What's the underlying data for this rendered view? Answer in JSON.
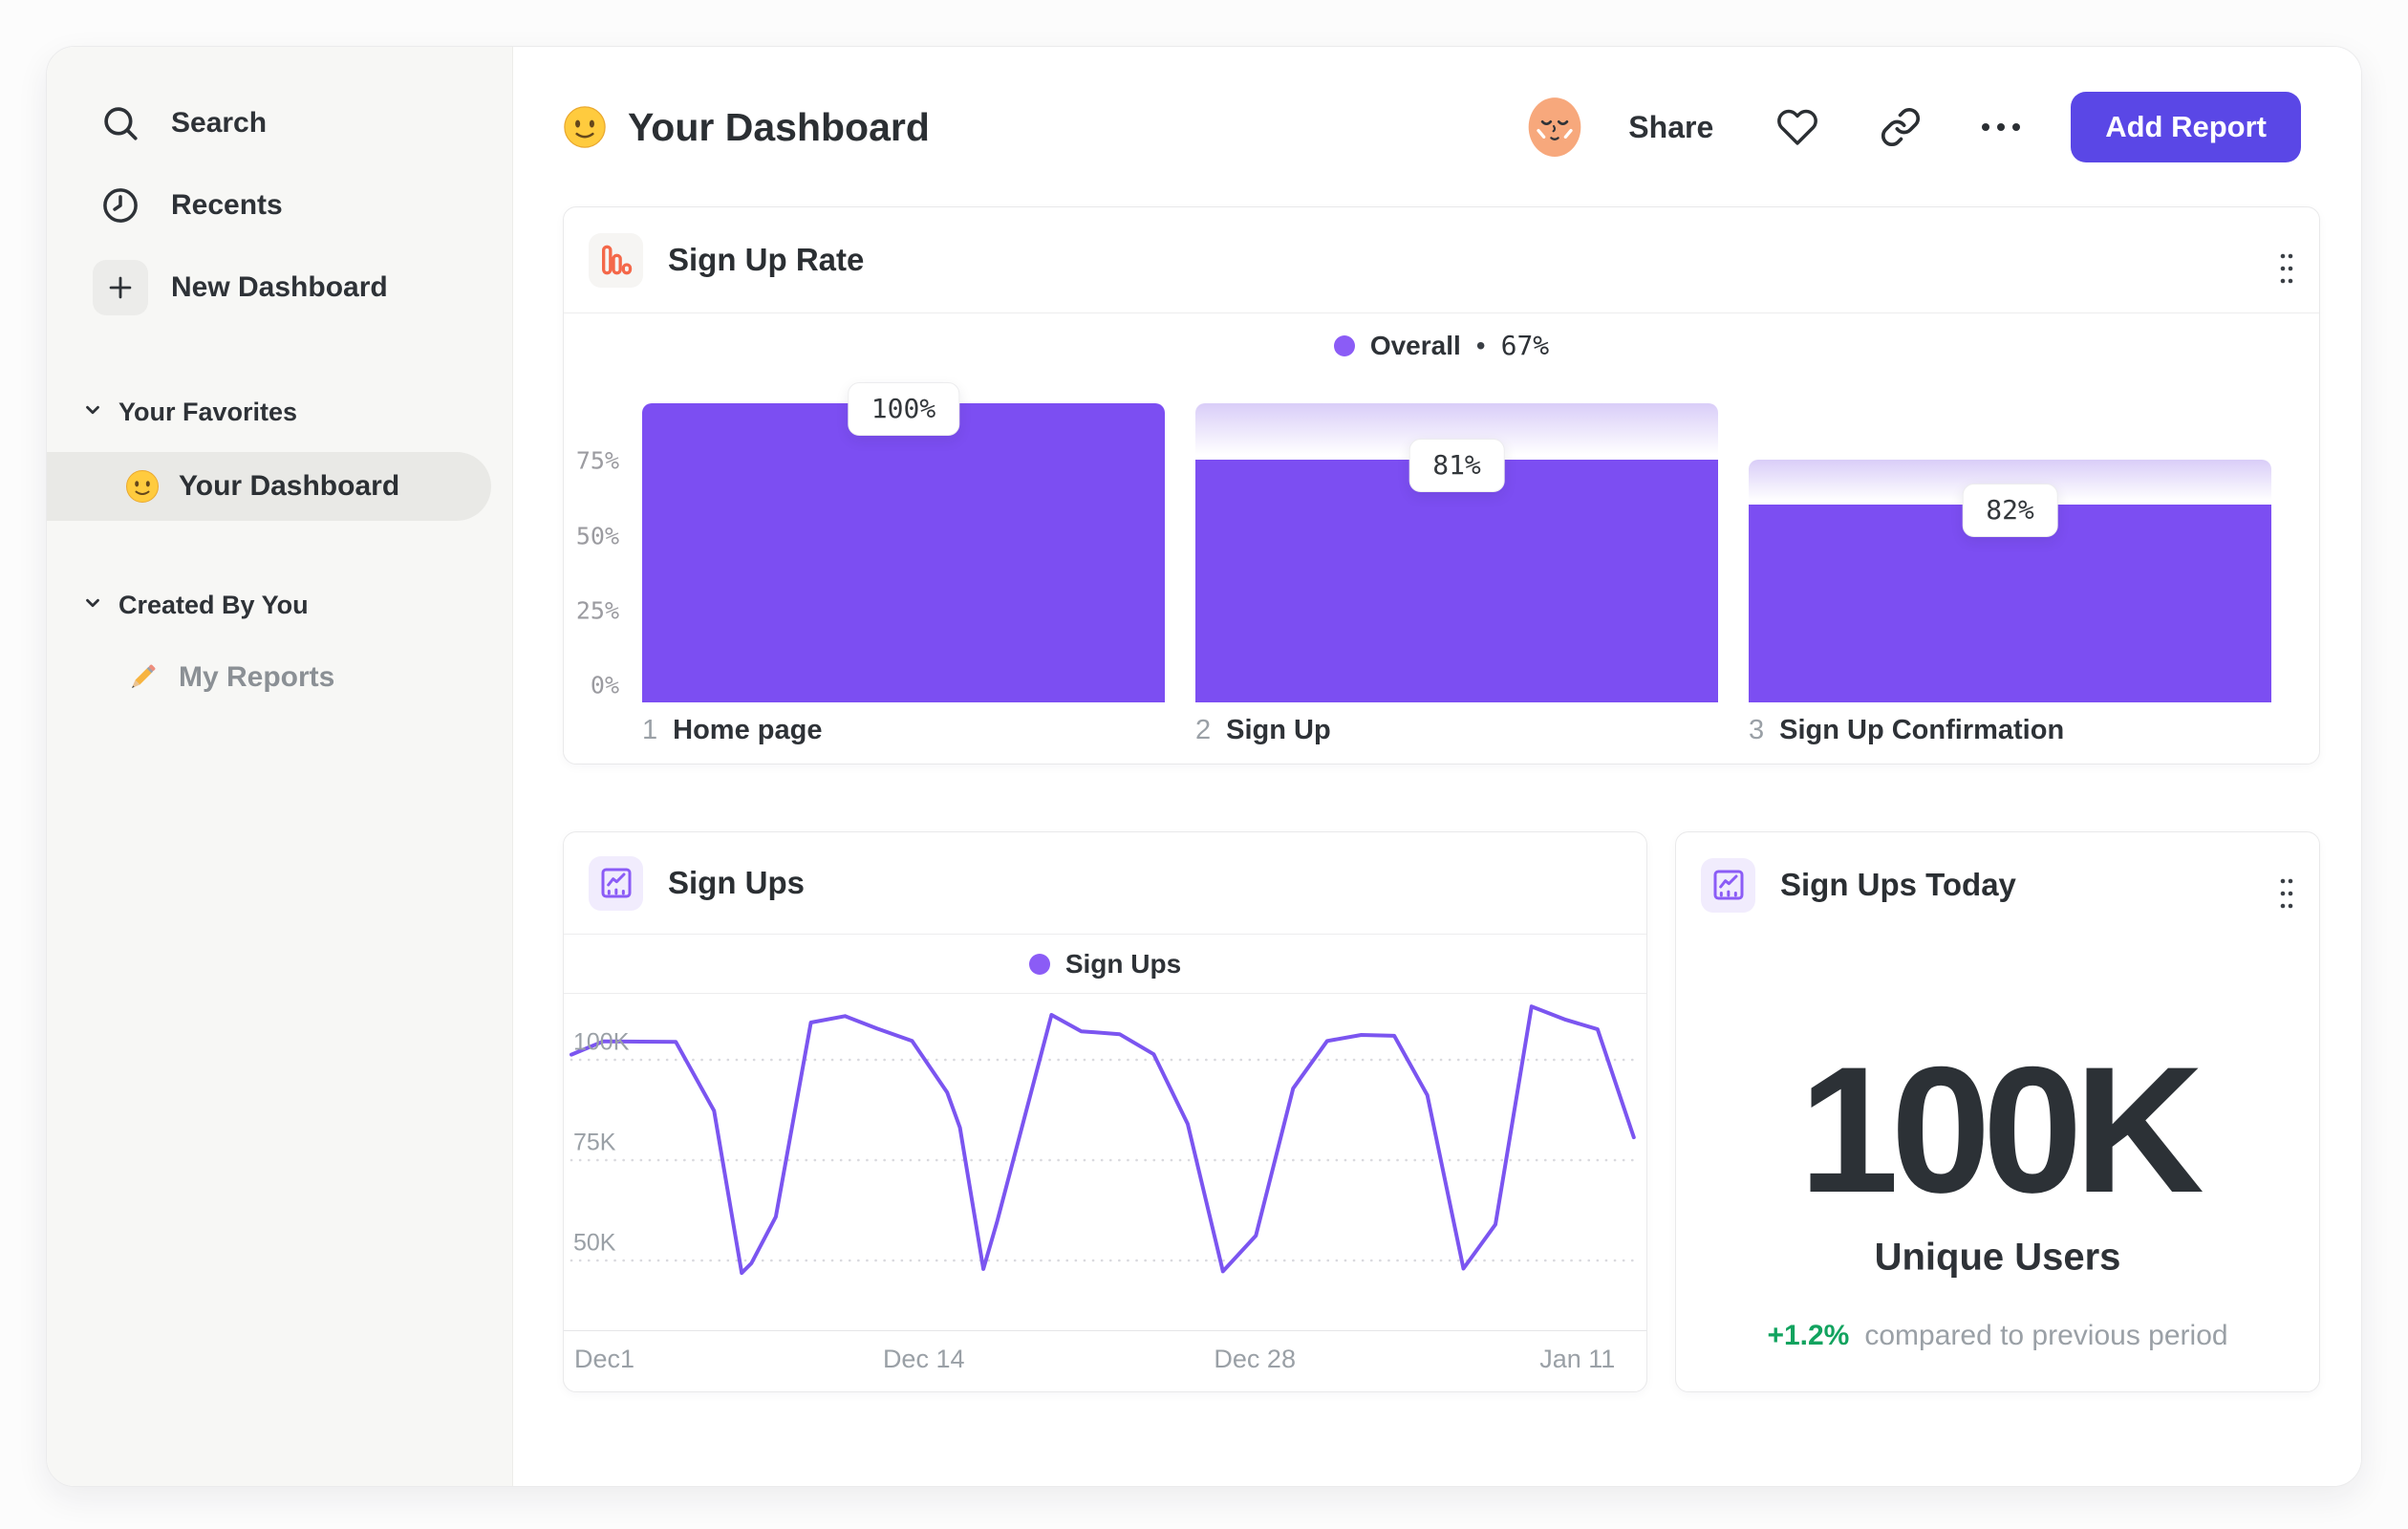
{
  "header": {
    "title_emoji": "slightly-smiling-face",
    "title": "Your Dashboard",
    "share_label": "Share",
    "add_report_label": "Add Report",
    "add_report_color": "#5a47e6"
  },
  "sidebar": {
    "nav": [
      {
        "icon": "search-icon",
        "label": "Search"
      },
      {
        "icon": "clock-icon",
        "label": "Recents"
      },
      {
        "icon": "plus-icon",
        "label": "New Dashboard"
      }
    ],
    "sections": [
      {
        "label": "Your Favorites",
        "items": [
          {
            "emoji": "slightly-smiling-face",
            "label": "Your Dashboard",
            "selected": true
          }
        ]
      },
      {
        "label": "Created By You",
        "items": [
          {
            "emoji": "pencil",
            "label": "My Reports",
            "selected": false
          }
        ]
      }
    ]
  },
  "cards": {
    "funnel": {
      "title": "Sign Up Rate",
      "icon": "funnel-bars-icon",
      "icon_color": "#f4684a"
    },
    "line": {
      "title": "Sign Ups",
      "icon": "line-chart-icon",
      "icon_color": "#8b5cf6"
    },
    "kpi": {
      "title": "Sign Ups Today",
      "icon": "line-chart-icon",
      "icon_color": "#8b5cf6",
      "value": "100K",
      "value_label": "Unique Users",
      "delta": "+1.2%",
      "delta_color": "#12a35f",
      "delta_description": "compared to previous period"
    }
  },
  "chart_data": [
    {
      "id": "sign-up-rate-funnel",
      "type": "bar",
      "variant": "funnel",
      "title": "Sign Up Rate",
      "legend": {
        "label": "Overall",
        "separator": "•",
        "value": "67%",
        "dot_color": "#8b5cf6"
      },
      "categories": [
        "Home page",
        "Sign Up",
        "Sign Up Confirmation"
      ],
      "step_numbers": [
        "1",
        "2",
        "3"
      ],
      "step_conversion_labels": [
        "100%",
        "81%",
        "82%"
      ],
      "values_pct_of_total": [
        100,
        81,
        66
      ],
      "previous_step_pct": [
        100,
        100,
        81
      ],
      "y_ticks": [
        "75%",
        "50%",
        "25%",
        "0%"
      ],
      "y_tick_values": [
        75,
        50,
        25,
        0
      ],
      "ylim": [
        0,
        100
      ],
      "bar_color": "#7c4ef2",
      "gradient_top_color": "#d9cdf8",
      "grid": false,
      "legend_position": "top-center"
    },
    {
      "id": "sign-ups-line",
      "type": "line",
      "title": "Sign Ups",
      "legend": {
        "label": "Sign Ups",
        "dot_color": "#8b5cf6"
      },
      "line_color": "#7b55f0",
      "unit": "K users",
      "x_ticks": [
        {
          "label": "Dec1",
          "pos_pct": 3.1
        },
        {
          "label": "Dec 14",
          "pos_pct": 33.1
        },
        {
          "label": "Dec 28",
          "pos_pct": 64.2
        },
        {
          "label": "Jan 11",
          "pos_pct": 94.5
        }
      ],
      "y_ticks": [
        {
          "label": "100K",
          "value": 100
        },
        {
          "label": "75K",
          "value": 75
        },
        {
          "label": "50K",
          "value": 50
        }
      ],
      "grid": "dotted-horizontal",
      "legend_position": "top-center",
      "points_x_pct_value_k": [
        [
          0,
          97
        ],
        [
          3,
          100.3
        ],
        [
          9.8,
          100.2
        ],
        [
          13.4,
          83
        ],
        [
          16,
          42.6
        ],
        [
          16.9,
          45
        ],
        [
          19.2,
          56.6
        ],
        [
          22.5,
          105
        ],
        [
          25.7,
          106.6
        ],
        [
          28.7,
          103.5
        ],
        [
          32,
          100.4
        ],
        [
          35.3,
          87.6
        ],
        [
          36.5,
          78.8
        ],
        [
          38.7,
          43.6
        ],
        [
          40,
          55.5
        ],
        [
          45.1,
          106.9
        ],
        [
          47.9,
          102.8
        ],
        [
          51.5,
          102.1
        ],
        [
          54.7,
          97.1
        ],
        [
          57.9,
          79.7
        ],
        [
          61.2,
          43
        ],
        [
          64.3,
          51.9
        ],
        [
          67.8,
          88.6
        ],
        [
          71,
          100.4
        ],
        [
          74.2,
          101.9
        ],
        [
          77.3,
          101.7
        ],
        [
          80.4,
          86.9
        ],
        [
          83.8,
          43.7
        ],
        [
          86.8,
          54.7
        ],
        [
          90.2,
          109
        ],
        [
          93.4,
          105.7
        ],
        [
          96.4,
          103.3
        ],
        [
          99.8,
          76.4
        ]
      ]
    }
  ]
}
